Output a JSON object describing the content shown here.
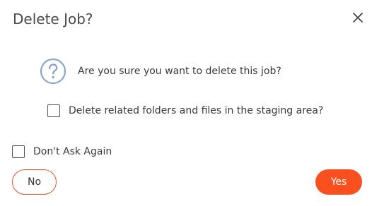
{
  "dialog": {
    "title": "Delete Job?",
    "close_icon": "close-icon",
    "question_icon": "question-circle-icon",
    "question": "Are you sure you want to delete this job?",
    "related_checkbox_label": "Delete related folders and files in the staging area?",
    "related_checked": false,
    "dont_ask_label": "Don't Ask Again",
    "dont_ask_checked": false,
    "no_label": "No",
    "yes_label": "Yes"
  },
  "colors": {
    "accent": "#fa4f1e",
    "accent_border": "#e8542a",
    "icon_blue": "#8aa6c8",
    "text": "#333333"
  }
}
